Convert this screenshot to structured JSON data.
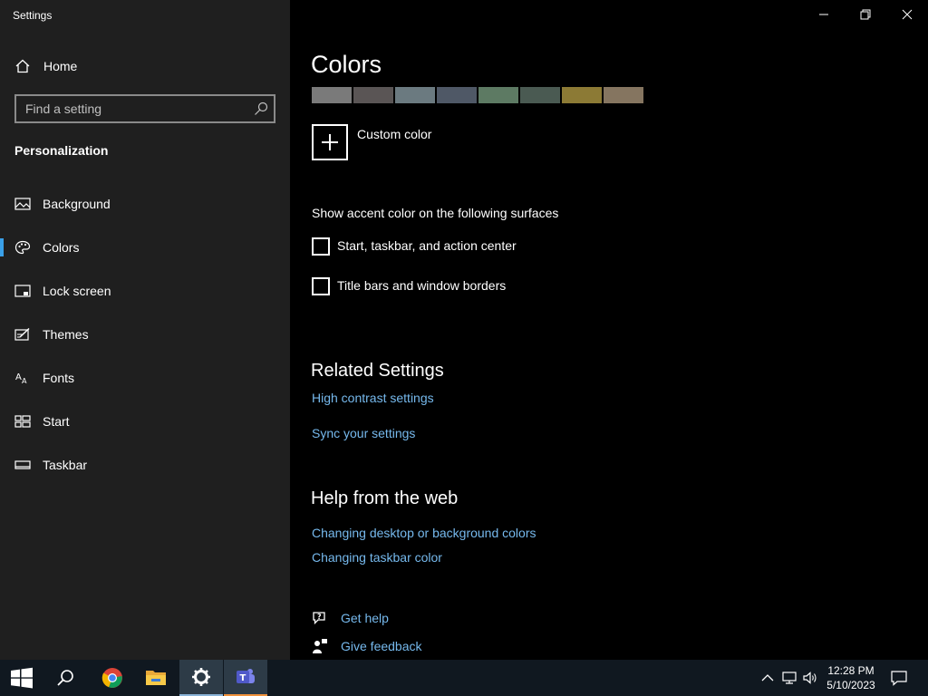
{
  "window": {
    "title": "Settings",
    "controls": [
      "minimize",
      "restore",
      "close"
    ]
  },
  "sidebar": {
    "home_label": "Home",
    "search_placeholder": "Find a setting",
    "section_title": "Personalization",
    "items": [
      {
        "label": "Background",
        "icon": "image-icon"
      },
      {
        "label": "Colors",
        "icon": "palette-icon",
        "active": true
      },
      {
        "label": "Lock screen",
        "icon": "lock-screen-icon"
      },
      {
        "label": "Themes",
        "icon": "themes-icon"
      },
      {
        "label": "Fonts",
        "icon": "fonts-icon"
      },
      {
        "label": "Start",
        "icon": "start-icon"
      },
      {
        "label": "Taskbar",
        "icon": "taskbar-icon"
      }
    ],
    "accent_color": "#3aa0e8"
  },
  "main": {
    "title": "Colors",
    "swatches": [
      "#7a7a7a",
      "#5a5555",
      "#6b7a80",
      "#4f5866",
      "#5d7a63",
      "#4a5a52",
      "#8c7a35",
      "#857560"
    ],
    "custom_color_label": "Custom color",
    "surfaces_label": "Show accent color on the following surfaces",
    "checkboxes": [
      {
        "label": "Start, taskbar, and action center",
        "checked": false
      },
      {
        "label": "Title bars and window borders",
        "checked": false
      }
    ],
    "related": {
      "heading": "Related Settings",
      "links": [
        "High contrast settings",
        "Sync your settings"
      ]
    },
    "help": {
      "heading": "Help from the web",
      "links": [
        "Changing desktop or background colors",
        "Changing taskbar color"
      ]
    },
    "get_help_label": "Get help",
    "give_feedback_label": "Give feedback",
    "link_color": "#76b9ed"
  },
  "taskbar": {
    "apps": [
      "windows-start-icon",
      "search-icon",
      "chrome-icon",
      "file-explorer-icon",
      "settings-gear-icon",
      "teams-icon"
    ],
    "time": "12:28 PM",
    "date": "5/10/2023"
  }
}
